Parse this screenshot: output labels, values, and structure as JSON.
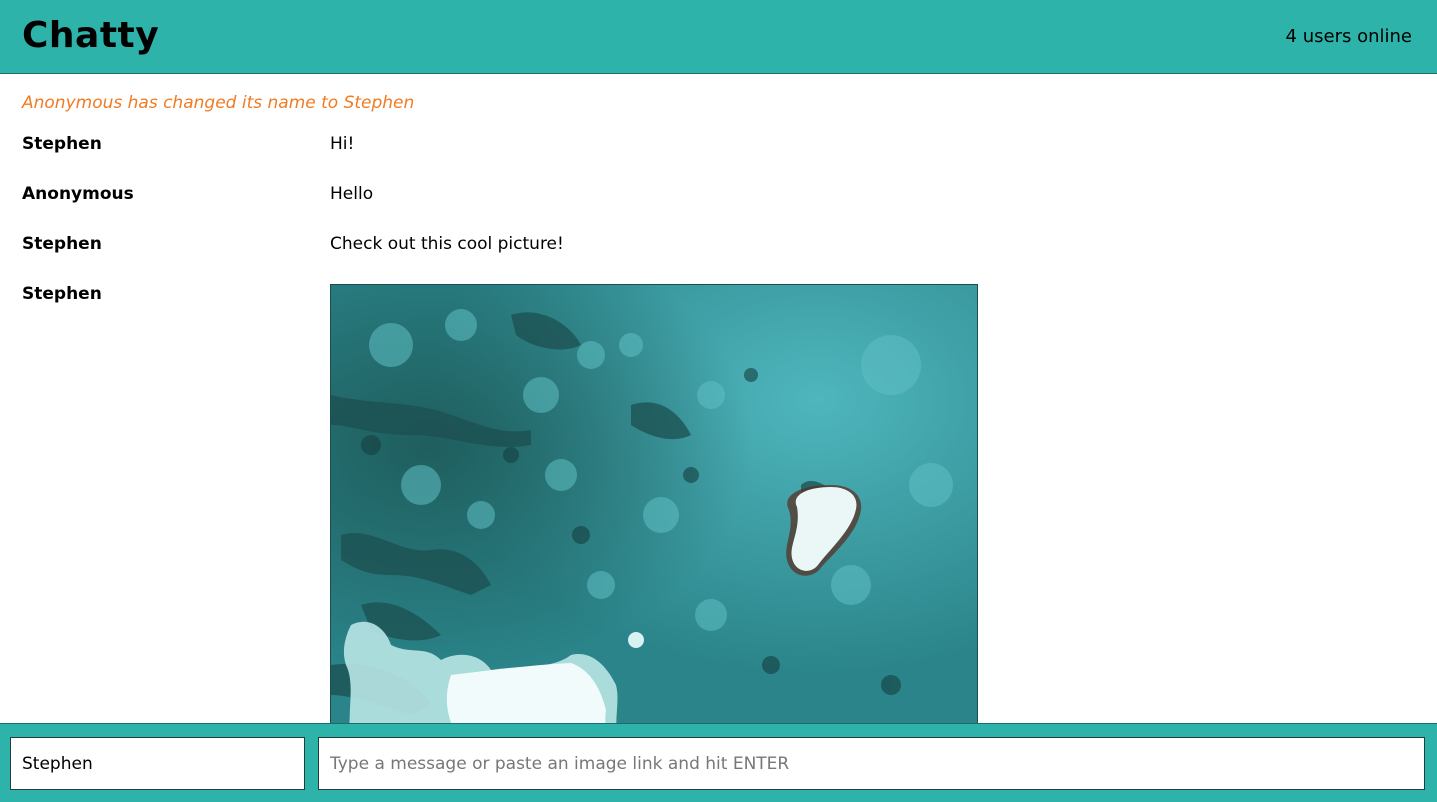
{
  "navbar": {
    "brand": "Chatty",
    "users_online": "4 users online"
  },
  "notification": "Anonymous has changed its name to Stephen",
  "messages": [
    {
      "username": "Stephen",
      "content": "Hi!"
    },
    {
      "username": "Anonymous",
      "content": "Hello"
    },
    {
      "username": "Stephen",
      "content": "Check out this cool picture!"
    },
    {
      "username": "Stephen",
      "content_type": "image",
      "image_description_icon": "satellite-sea-ice-image"
    }
  ],
  "chatbar": {
    "username_value": "Stephen",
    "message_placeholder": "Type a message or paste an image link and hit ENTER"
  },
  "colors": {
    "accent": "#2db3aa",
    "notification": "#f07b22"
  }
}
